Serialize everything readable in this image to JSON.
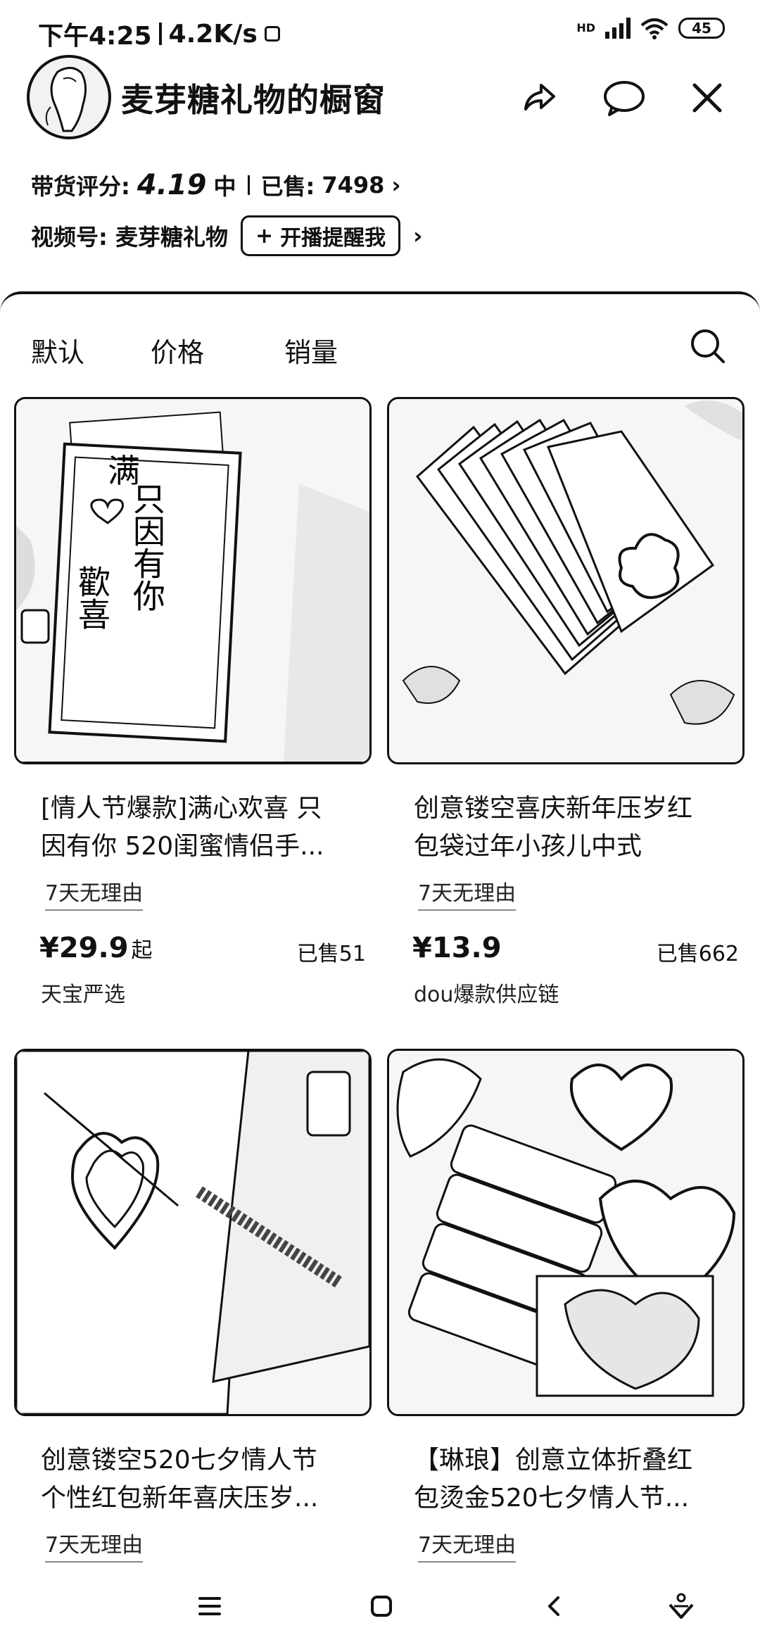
{
  "status_bar": {
    "time": "下午4:25",
    "speed": "4.2K/s",
    "network": "HD",
    "battery": "45"
  },
  "header": {
    "shop_name": "麦芽糖礼物的橱窗",
    "icons": [
      "share-icon",
      "chat-icon",
      "close-icon"
    ]
  },
  "stats": {
    "rating_label": "带货评分:",
    "rating_value": "4.19",
    "rating_level": "中",
    "sold_label": "已售:",
    "sold_value": "7498"
  },
  "channel": {
    "label": "视频号: 麦芽糖礼物",
    "remind_button": "开播提醒我"
  },
  "sort_tabs": [
    "默认",
    "价格",
    "销量"
  ],
  "products": [
    {
      "title_line1": "[情人节爆款]满心欢喜 只",
      "title_line2": "因有你 520闺蜜情侣手...",
      "tag": "7天无理由",
      "price": "¥29.9",
      "price_suffix": "起",
      "sold": "已售51",
      "shop": "天宝严选",
      "thumb_text_a": "只因有你",
      "thumb_text_b": "满",
      "thumb_text_c": "歡喜"
    },
    {
      "title_line1": "创意镂空喜庆新年压岁红",
      "title_line2": "包袋过年小孩儿中式",
      "tag": "7天无理由",
      "price": "¥13.9",
      "price_suffix": "",
      "sold": "已售662",
      "shop": "dou爆款供应链"
    },
    {
      "title_line1": "创意镂空520七夕情人节",
      "title_line2": "个性红包新年喜庆压岁...",
      "tag": "7天无理由"
    },
    {
      "title_line1": "【琳琅】创意立体折叠红",
      "title_line2": "包烫金520七夕情人节...",
      "tag": "7天无理由"
    }
  ],
  "nav": [
    "menu-icon",
    "home-icon",
    "back-icon",
    "assistant-icon"
  ]
}
